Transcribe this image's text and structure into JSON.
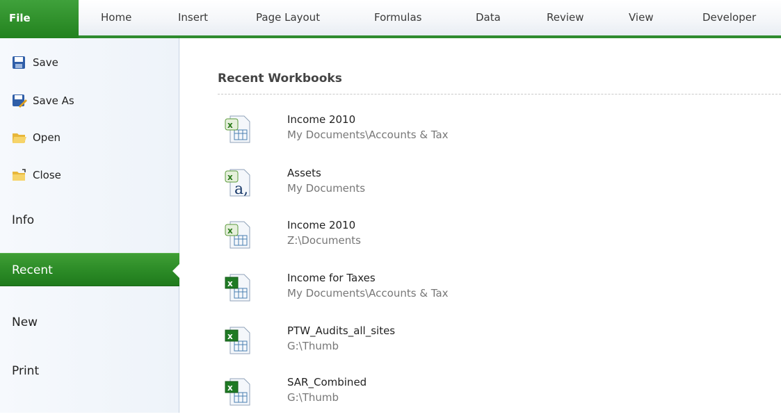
{
  "ribbon": {
    "tabs": [
      "File",
      "Home",
      "Insert",
      "Page Layout",
      "Formulas",
      "Data",
      "Review",
      "View",
      "Developer"
    ],
    "accent": "#2e8b2e"
  },
  "backstage": {
    "commands": [
      {
        "label": "Save",
        "icon": "save-icon"
      },
      {
        "label": "Save As",
        "icon": "save-as-icon"
      },
      {
        "label": "Open",
        "icon": "open-folder-icon"
      },
      {
        "label": "Close",
        "icon": "close-folder-icon"
      }
    ],
    "nav": [
      "Info",
      "Recent",
      "New",
      "Print"
    ],
    "selected_nav": "Recent"
  },
  "recent": {
    "title": "Recent Workbooks",
    "items": [
      {
        "name": "Income 2010",
        "path": "My Documents\\Accounts & Tax",
        "icon": "excel-2010-workbook-icon"
      },
      {
        "name": "Assets",
        "path": "My Documents",
        "icon": "excel-2010-ods-icon"
      },
      {
        "name": "Income 2010",
        "path": "Z:\\Documents",
        "icon": "excel-2010-workbook-icon"
      },
      {
        "name": "Income for Taxes",
        "path": "My Documents\\Accounts & Tax",
        "icon": "excel-workbook-icon"
      },
      {
        "name": "PTW_Audits_all_sites",
        "path": "G:\\Thumb",
        "icon": "excel-workbook-icon"
      },
      {
        "name": "SAR_Combined",
        "path": "G:\\Thumb",
        "icon": "excel-workbook-icon"
      }
    ]
  }
}
